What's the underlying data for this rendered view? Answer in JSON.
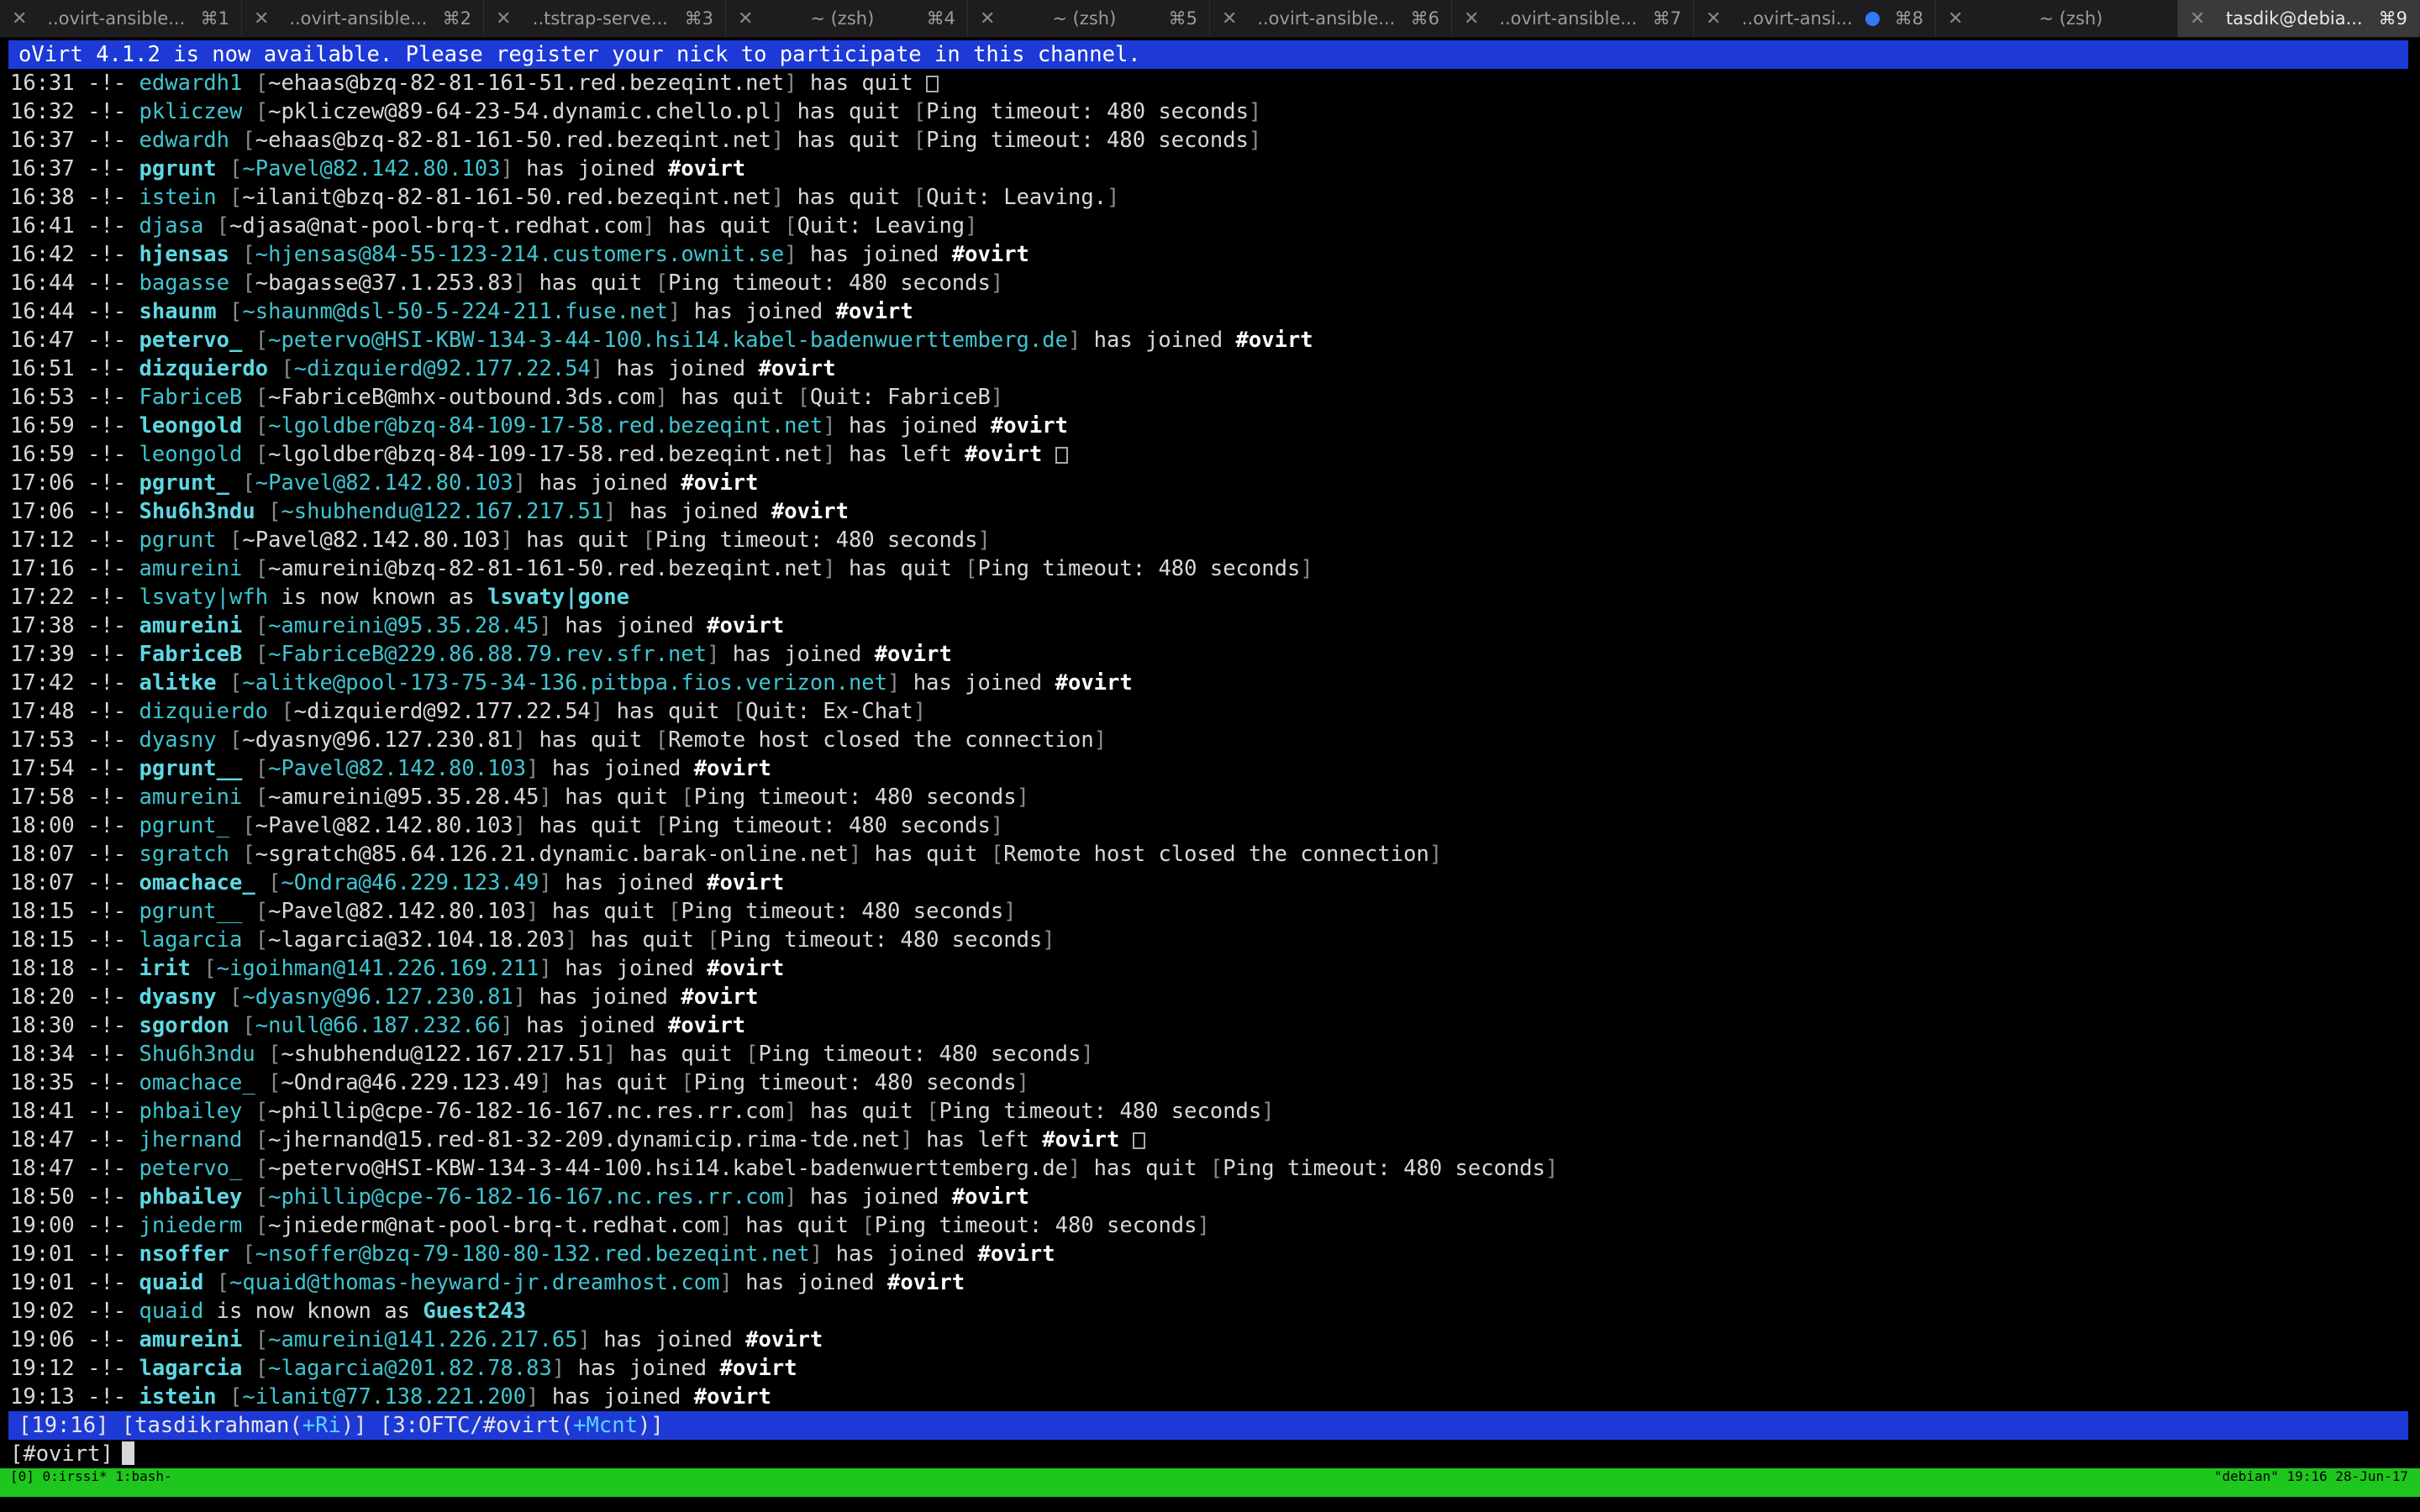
{
  "tabs": [
    {
      "title": "..ovirt-ansible...",
      "shortcut": "⌘1",
      "active": false,
      "dot": false
    },
    {
      "title": "..ovirt-ansible...",
      "shortcut": "⌘2",
      "active": false,
      "dot": false
    },
    {
      "title": "..tstrap-serve...",
      "shortcut": "⌘3",
      "active": false,
      "dot": false
    },
    {
      "title": "~ (zsh)",
      "shortcut": "⌘4",
      "active": false,
      "dot": false
    },
    {
      "title": "~ (zsh)",
      "shortcut": "⌘5",
      "active": false,
      "dot": false
    },
    {
      "title": "..ovirt-ansible...",
      "shortcut": "⌘6",
      "active": false,
      "dot": false
    },
    {
      "title": "..ovirt-ansible...",
      "shortcut": "⌘7",
      "active": false,
      "dot": false
    },
    {
      "title": "..ovirt-ansi...",
      "shortcut": "⌘8",
      "active": false,
      "dot": true
    },
    {
      "title": "~ (zsh)",
      "shortcut": "",
      "active": false,
      "dot": false
    },
    {
      "title": "tasdik@debia...",
      "shortcut": "⌘9",
      "active": true,
      "dot": false
    }
  ],
  "topic": "oVirt 4.1.2 is now available. Please register your nick to participate in this channel.",
  "marker": "-!-",
  "messages": [
    {
      "time": "16:31",
      "nick": "edwardh1",
      "host": "~ehaas@bzq-82-81-161-51.red.bezeqint.net",
      "action": "has quit",
      "reason": "",
      "box": true,
      "join": false
    },
    {
      "time": "16:32",
      "nick": "pkliczew",
      "host": "~pkliczew@89-64-23-54.dynamic.chello.pl",
      "action": "has quit",
      "reason": "Ping timeout: 480 seconds",
      "join": false
    },
    {
      "time": "16:37",
      "nick": "edwardh",
      "host": "~ehaas@bzq-82-81-161-50.red.bezeqint.net",
      "action": "has quit",
      "reason": "Ping timeout: 480 seconds",
      "join": false
    },
    {
      "time": "16:37",
      "nick": "pgrunt",
      "host": "~Pavel@82.142.80.103",
      "action": "has joined",
      "channel": "#ovirt",
      "join": true
    },
    {
      "time": "16:38",
      "nick": "istein",
      "host": "~ilanit@bzq-82-81-161-50.red.bezeqint.net",
      "action": "has quit",
      "reason": "Quit: Leaving.",
      "join": false
    },
    {
      "time": "16:41",
      "nick": "djasa",
      "host": "~djasa@nat-pool-brq-t.redhat.com",
      "action": "has quit",
      "reason": "Quit: Leaving",
      "join": false
    },
    {
      "time": "16:42",
      "nick": "hjensas",
      "host": "~hjensas@84-55-123-214.customers.ownit.se",
      "action": "has joined",
      "channel": "#ovirt",
      "join": true
    },
    {
      "time": "16:44",
      "nick": "bagasse",
      "host": "~bagasse@37.1.253.83",
      "action": "has quit",
      "reason": "Ping timeout: 480 seconds",
      "join": false
    },
    {
      "time": "16:44",
      "nick": "shaunm",
      "host": "~shaunm@dsl-50-5-224-211.fuse.net",
      "action": "has joined",
      "channel": "#ovirt",
      "join": true
    },
    {
      "time": "16:47",
      "nick": "petervo_",
      "host": "~petervo@HSI-KBW-134-3-44-100.hsi14.kabel-badenwuerttemberg.de",
      "action": "has joined",
      "channel": "#ovirt",
      "join": true
    },
    {
      "time": "16:51",
      "nick": "dizquierdo",
      "host": "~dizquierd@92.177.22.54",
      "action": "has joined",
      "channel": "#ovirt",
      "join": true
    },
    {
      "time": "16:53",
      "nick": "FabriceB",
      "host": "~FabriceB@mhx-outbound.3ds.com",
      "action": "has quit",
      "reason": "Quit: FabriceB",
      "join": false
    },
    {
      "time": "16:59",
      "nick": "leongold",
      "host": "~lgoldber@bzq-84-109-17-58.red.bezeqint.net",
      "action": "has joined",
      "channel": "#ovirt",
      "join": true
    },
    {
      "time": "16:59",
      "nick": "leongold",
      "host": "~lgoldber@bzq-84-109-17-58.red.bezeqint.net",
      "action": "has left",
      "channel": "#ovirt",
      "box": true,
      "join": false,
      "left": true
    },
    {
      "time": "17:06",
      "nick": "pgrunt_",
      "host": "~Pavel@82.142.80.103",
      "action": "has joined",
      "channel": "#ovirt",
      "join": true
    },
    {
      "time": "17:06",
      "nick": "Shu6h3ndu",
      "host": "~shubhendu@122.167.217.51",
      "action": "has joined",
      "channel": "#ovirt",
      "join": true
    },
    {
      "time": "17:12",
      "nick": "pgrunt",
      "host": "~Pavel@82.142.80.103",
      "action": "has quit",
      "reason": "Ping timeout: 480 seconds",
      "join": false
    },
    {
      "time": "17:16",
      "nick": "amureini",
      "host": "~amureini@bzq-82-81-161-50.red.bezeqint.net",
      "action": "has quit",
      "reason": "Ping timeout: 480 seconds",
      "join": false
    },
    {
      "time": "17:22",
      "nick": "lsvaty|wfh",
      "action": "is now known as",
      "newnick": "lsvaty|gone",
      "rename": true
    },
    {
      "time": "17:38",
      "nick": "amureini",
      "host": "~amureini@95.35.28.45",
      "action": "has joined",
      "channel": "#ovirt",
      "join": true
    },
    {
      "time": "17:39",
      "nick": "FabriceB",
      "host": "~FabriceB@229.86.88.79.rev.sfr.net",
      "action": "has joined",
      "channel": "#ovirt",
      "join": true
    },
    {
      "time": "17:42",
      "nick": "alitke",
      "host": "~alitke@pool-173-75-34-136.pitbpa.fios.verizon.net",
      "action": "has joined",
      "channel": "#ovirt",
      "join": true
    },
    {
      "time": "17:48",
      "nick": "dizquierdo",
      "host": "~dizquierd@92.177.22.54",
      "action": "has quit",
      "reason": "Quit: Ex-Chat",
      "join": false
    },
    {
      "time": "17:53",
      "nick": "dyasny",
      "host": "~dyasny@96.127.230.81",
      "action": "has quit",
      "reason": "Remote host closed the connection",
      "join": false
    },
    {
      "time": "17:54",
      "nick": "pgrunt__",
      "host": "~Pavel@82.142.80.103",
      "action": "has joined",
      "channel": "#ovirt",
      "join": true
    },
    {
      "time": "17:58",
      "nick": "amureini",
      "host": "~amureini@95.35.28.45",
      "action": "has quit",
      "reason": "Ping timeout: 480 seconds",
      "join": false
    },
    {
      "time": "18:00",
      "nick": "pgrunt_",
      "host": "~Pavel@82.142.80.103",
      "action": "has quit",
      "reason": "Ping timeout: 480 seconds",
      "join": false
    },
    {
      "time": "18:07",
      "nick": "sgratch",
      "host": "~sgratch@85.64.126.21.dynamic.barak-online.net",
      "action": "has quit",
      "reason": "Remote host closed the connection",
      "join": false
    },
    {
      "time": "18:07",
      "nick": "omachace_",
      "host": "~Ondra@46.229.123.49",
      "action": "has joined",
      "channel": "#ovirt",
      "join": true
    },
    {
      "time": "18:15",
      "nick": "pgrunt__",
      "host": "~Pavel@82.142.80.103",
      "action": "has quit",
      "reason": "Ping timeout: 480 seconds",
      "join": false
    },
    {
      "time": "18:15",
      "nick": "lagarcia",
      "host": "~lagarcia@32.104.18.203",
      "action": "has quit",
      "reason": "Ping timeout: 480 seconds",
      "join": false
    },
    {
      "time": "18:18",
      "nick": "irit",
      "host": "~igoihman@141.226.169.211",
      "action": "has joined",
      "channel": "#ovirt",
      "join": true
    },
    {
      "time": "18:20",
      "nick": "dyasny",
      "host": "~dyasny@96.127.230.81",
      "action": "has joined",
      "channel": "#ovirt",
      "join": true
    },
    {
      "time": "18:30",
      "nick": "sgordon",
      "host": "~null@66.187.232.66",
      "action": "has joined",
      "channel": "#ovirt",
      "join": true
    },
    {
      "time": "18:34",
      "nick": "Shu6h3ndu",
      "host": "~shubhendu@122.167.217.51",
      "action": "has quit",
      "reason": "Ping timeout: 480 seconds",
      "join": false
    },
    {
      "time": "18:35",
      "nick": "omachace_",
      "host": "~Ondra@46.229.123.49",
      "action": "has quit",
      "reason": "Ping timeout: 480 seconds",
      "join": false
    },
    {
      "time": "18:41",
      "nick": "phbailey",
      "host": "~phillip@cpe-76-182-16-167.nc.res.rr.com",
      "action": "has quit",
      "reason": "Ping timeout: 480 seconds",
      "join": false
    },
    {
      "time": "18:47",
      "nick": "jhernand",
      "host": "~jhernand@15.red-81-32-209.dynamicip.rima-tde.net",
      "action": "has left",
      "channel": "#ovirt",
      "box": true,
      "join": false,
      "left": true
    },
    {
      "time": "18:47",
      "nick": "petervo_",
      "host": "~petervo@HSI-KBW-134-3-44-100.hsi14.kabel-badenwuerttemberg.de",
      "action": "has quit",
      "reason": "Ping timeout: 480 seconds",
      "join": false
    },
    {
      "time": "18:50",
      "nick": "phbailey",
      "host": "~phillip@cpe-76-182-16-167.nc.res.rr.com",
      "action": "has joined",
      "channel": "#ovirt",
      "join": true
    },
    {
      "time": "19:00",
      "nick": "jniederm",
      "host": "~jniederm@nat-pool-brq-t.redhat.com",
      "action": "has quit",
      "reason": "Ping timeout: 480 seconds",
      "join": false
    },
    {
      "time": "19:01",
      "nick": "nsoffer",
      "host": "~nsoffer@bzq-79-180-80-132.red.bezeqint.net",
      "action": "has joined",
      "channel": "#ovirt",
      "join": true
    },
    {
      "time": "19:01",
      "nick": "quaid",
      "host": "~quaid@thomas-heyward-jr.dreamhost.com",
      "action": "has joined",
      "channel": "#ovirt",
      "join": true
    },
    {
      "time": "19:02",
      "nick": "quaid",
      "action": "is now known as",
      "newnick": "Guest243",
      "rename": true
    },
    {
      "time": "19:06",
      "nick": "amureini",
      "host": "~amureini@141.226.217.65",
      "action": "has joined",
      "channel": "#ovirt",
      "join": true
    },
    {
      "time": "19:12",
      "nick": "lagarcia",
      "host": "~lagarcia@201.82.78.83",
      "action": "has joined",
      "channel": "#ovirt",
      "join": true
    },
    {
      "time": "19:13",
      "nick": "istein",
      "host": "~ilanit@77.138.221.200",
      "action": "has joined",
      "channel": "#ovirt",
      "join": true
    }
  ],
  "status": {
    "time": "[19:16]",
    "user_pre": "[tasdikrahman(",
    "user_mode": "+Ri",
    "user_post": ")]",
    "win_pre": "[3:OFTC/#ovirt(",
    "win_mode": "+Mcnt",
    "win_post": ")]"
  },
  "input": {
    "prompt": "[#ovirt]"
  },
  "tmux": {
    "left": "[0] 0:irssi* 1:bash-",
    "right": "\"debian\" 19:16 28-Jun-17"
  },
  "colors": {
    "topic_bar": "#1d3ad6",
    "tmux_bar": "#1ec71e",
    "nick": "#3fc5d0",
    "tab_dot": "#3478f6"
  }
}
